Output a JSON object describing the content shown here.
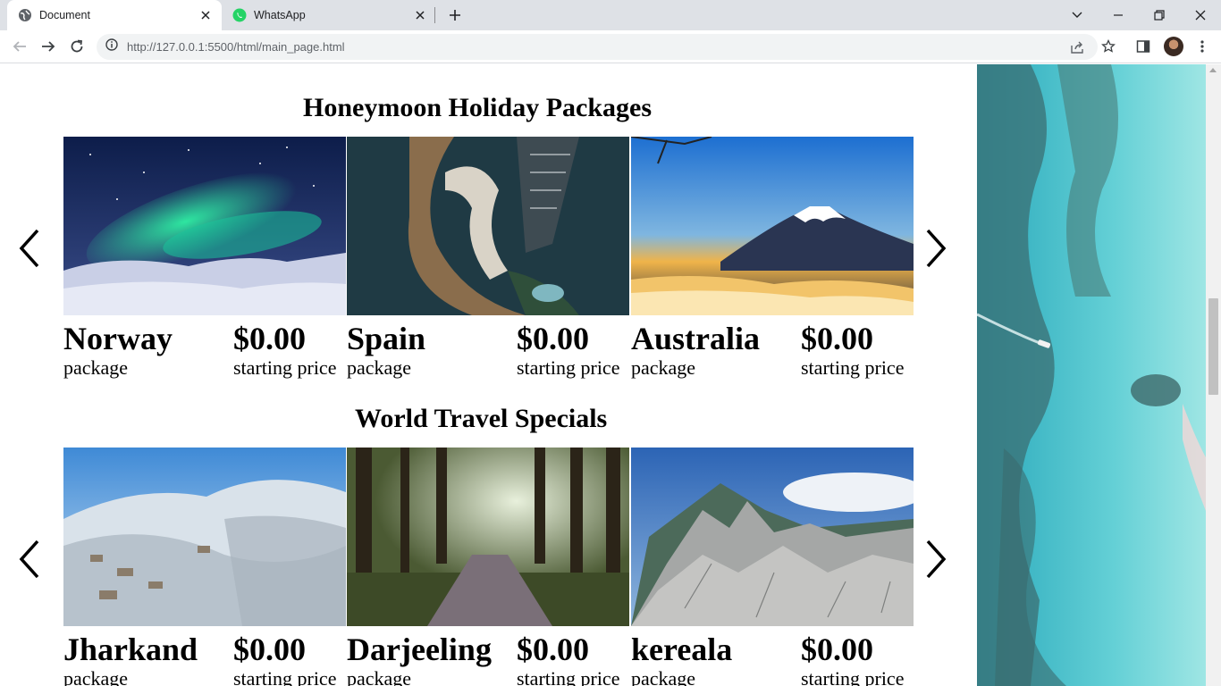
{
  "browser": {
    "tabs": [
      {
        "title": "Document",
        "icon": "globe-icon",
        "active": true
      },
      {
        "title": "WhatsApp",
        "icon": "whatsapp-icon",
        "active": false
      }
    ],
    "url": "http://127.0.0.1:5500/html/main_page.html"
  },
  "sections": [
    {
      "title": "Honeymoon Holiday Packages",
      "cards": [
        {
          "name": "Norway",
          "price": "$0.00",
          "package_label": "package",
          "price_label": "starting price",
          "image": "aurora-landscape"
        },
        {
          "name": "Spain",
          "price": "$0.00",
          "package_label": "package",
          "price_label": "starting price",
          "image": "harbor-aerial"
        },
        {
          "name": "Australia",
          "price": "$0.00",
          "package_label": "package",
          "price_label": "starting price",
          "image": "mountain-sunset"
        }
      ]
    },
    {
      "title": "World Travel Specials",
      "cards": [
        {
          "name": "Jharkand",
          "price": "$0.00",
          "package_label": "package",
          "price_label": "starting price",
          "image": "snowy-hill-town"
        },
        {
          "name": "Darjeeling",
          "price": "$0.00",
          "package_label": "package",
          "price_label": "starting price",
          "image": "forest-path"
        },
        {
          "name": "kereala",
          "price": "$0.00",
          "package_label": "package",
          "price_label": "starting price",
          "image": "rocky-mountains"
        }
      ]
    }
  ],
  "colors": {
    "tabbar_bg": "#dee1e6",
    "omnibox_bg": "#f1f3f4",
    "whatsapp_green": "#25d366",
    "sea": "#4cc3cf"
  }
}
